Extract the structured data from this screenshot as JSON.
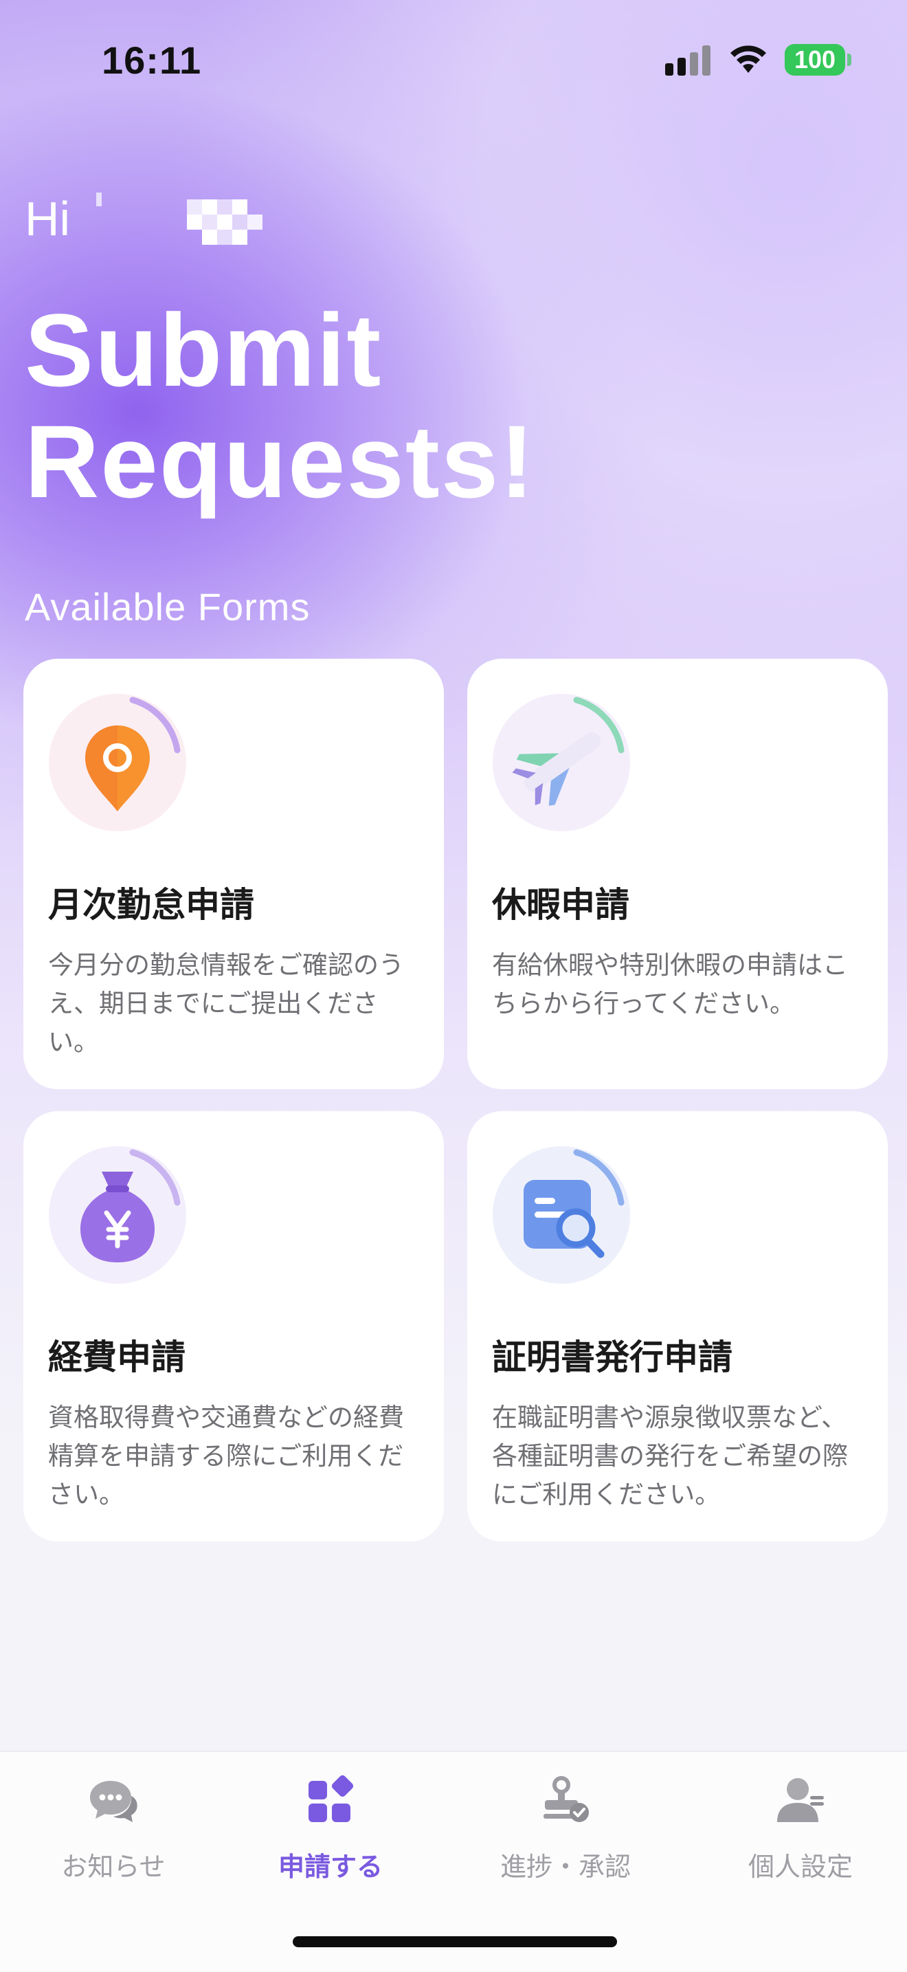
{
  "status_bar": {
    "time": "16:11",
    "battery": "100"
  },
  "header": {
    "greeting": "Hi",
    "title_line1": "Submit",
    "title_line2": "Requests!",
    "section_label": "Available Forms"
  },
  "forms": [
    {
      "title": "月次勤怠申請",
      "description": "今月分の勤怠情報をご確認のうえ、期日までにご提出ください。",
      "icon": "location-pin-icon"
    },
    {
      "title": "休暇申請",
      "description": "有給休暇や特別休暇の申請はこちらから行ってください。",
      "icon": "airplane-icon"
    },
    {
      "title": "経費申請",
      "description": "資格取得費や交通費などの経費精算を申請する際にご利用ください。",
      "icon": "yen-money-bag-icon"
    },
    {
      "title": "証明書発行申請",
      "description": "在職証明書や源泉徴収票など、各種証明書の発行をご希望の際にご利用ください。",
      "icon": "document-search-icon"
    }
  ],
  "bottom_nav": {
    "items": [
      {
        "label": "お知らせ",
        "icon": "chat-bubbles-icon",
        "active": false
      },
      {
        "label": "申請する",
        "icon": "apps-grid-icon",
        "active": true
      },
      {
        "label": "進捗・承認",
        "icon": "stamp-approve-icon",
        "active": false
      },
      {
        "label": "個人設定",
        "icon": "person-settings-icon",
        "active": false
      }
    ]
  },
  "colors": {
    "accent": "#7a5ae0",
    "inactive": "#9e9ea4",
    "battery": "#34c759",
    "hero_purple": "#8c5fee"
  }
}
